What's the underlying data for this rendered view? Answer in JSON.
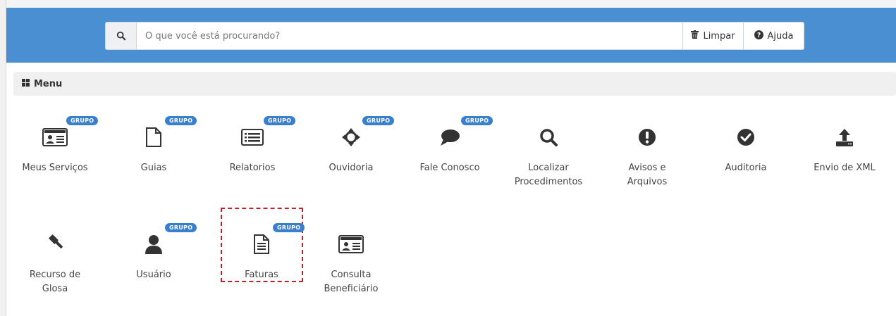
{
  "search": {
    "placeholder": "O que você está procurando?",
    "clear_label": "Limpar",
    "help_label": "Ajuda"
  },
  "menu": {
    "title": "Menu",
    "badge_label": "GRUPO",
    "items": [
      {
        "label": "Meus Serviços",
        "icon": "id-card-icon",
        "badge": true
      },
      {
        "label": "Guias",
        "icon": "file-icon",
        "badge": true
      },
      {
        "label": "Relatorios",
        "icon": "list-alt-icon",
        "badge": true
      },
      {
        "label": "Ouvidoria",
        "icon": "crosshairs-icon",
        "badge": true
      },
      {
        "label": "Fale Conosco",
        "icon": "comment-icon",
        "badge": true
      },
      {
        "label": "Localizar\nProcedimentos",
        "icon": "search-icon",
        "badge": false
      },
      {
        "label": "Avisos e\nArquivos",
        "icon": "exclamation-circle-icon",
        "badge": false
      },
      {
        "label": "Auditoria",
        "icon": "check-circle-icon",
        "badge": false
      },
      {
        "label": "Envio de XML",
        "icon": "upload-icon",
        "badge": false
      },
      {
        "label": "Recurso de\nGlosa",
        "icon": "gavel-icon",
        "badge": false
      },
      {
        "label": "Usuário",
        "icon": "user-icon",
        "badge": true
      },
      {
        "label": "Faturas",
        "icon": "file-text-icon",
        "badge": true
      },
      {
        "label": "Consulta\nBeneficiário",
        "icon": "id-card-icon",
        "badge": false
      }
    ]
  },
  "colors": {
    "header": "#4a8fd2",
    "badge": "#3a7fcb",
    "highlight": "#c0202b"
  }
}
